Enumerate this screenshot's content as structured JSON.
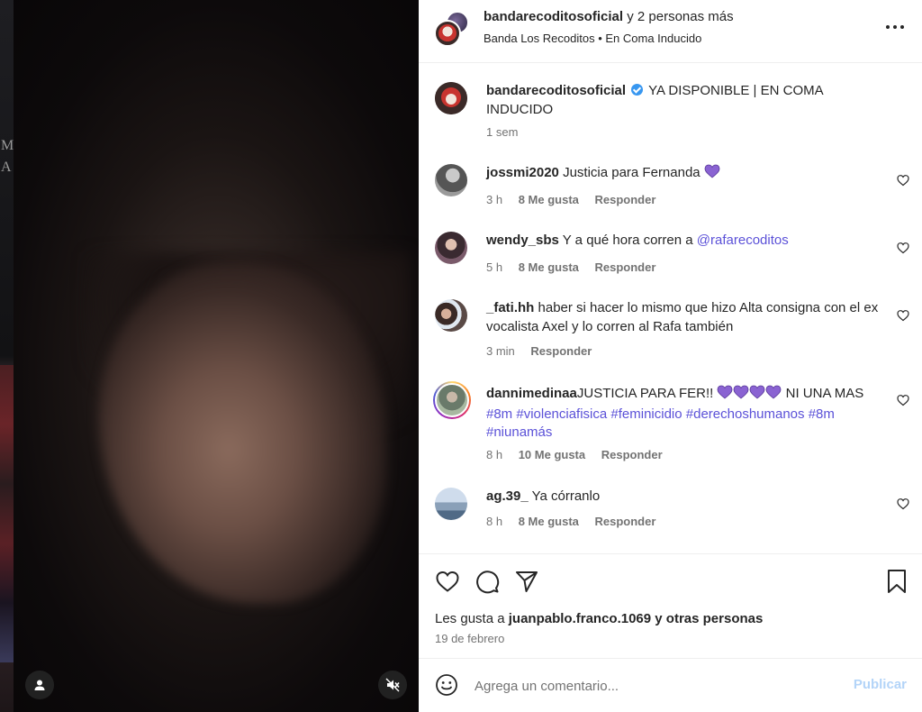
{
  "post": {
    "header": {
      "owner": "bandarecoditosoficial",
      "collab_suffix": " y 2 personas más",
      "subtitle": "Banda Los Recoditos • En Coma Inducido"
    },
    "caption": {
      "user": "bandarecoditosoficial",
      "text": "YA DISPONIBLE | EN COMA INDUCIDO",
      "time": "1 sem"
    },
    "comments": [
      {
        "user": "jossmi2020",
        "text": "Justicia para Fernanda",
        "emoji": "💜",
        "time": "3 h",
        "likes": "8 Me gusta",
        "reply": "Responder"
      },
      {
        "user": "wendy_sbs",
        "text": "Y a qué hora corren a ",
        "mention": "@rafarecoditos",
        "time": "5 h",
        "likes": "8 Me gusta",
        "reply": "Responder"
      },
      {
        "user": "_fati.hh",
        "text": "haber si hacer lo mismo que hizo Alta consigna con el ex vocalista Axel y lo corren al Rafa también",
        "time": "3 min",
        "reply": "Responder"
      },
      {
        "user": "dannimedinaa",
        "text_a": "JUSTICIA PARA FER!!",
        "text_b": "NI UNA MAS",
        "hashtags": "#8m #violenciafisica #feminicidio #derechoshumanos #8m #niunamás",
        "time": "8 h",
        "likes": "10 Me gusta",
        "reply": "Responder"
      },
      {
        "user": "ag.39_",
        "text": "Ya córranlo",
        "time": "8 h",
        "likes": "8 Me gusta",
        "reply": "Responder"
      }
    ],
    "likes": {
      "prefix": "Les gusta a ",
      "user": "juanpablo.franco.1069",
      "suffix": " y otras personas"
    },
    "date": "19 de febrero",
    "composer": {
      "placeholder": "Agrega un comentario...",
      "post_label": "Publicar"
    }
  }
}
